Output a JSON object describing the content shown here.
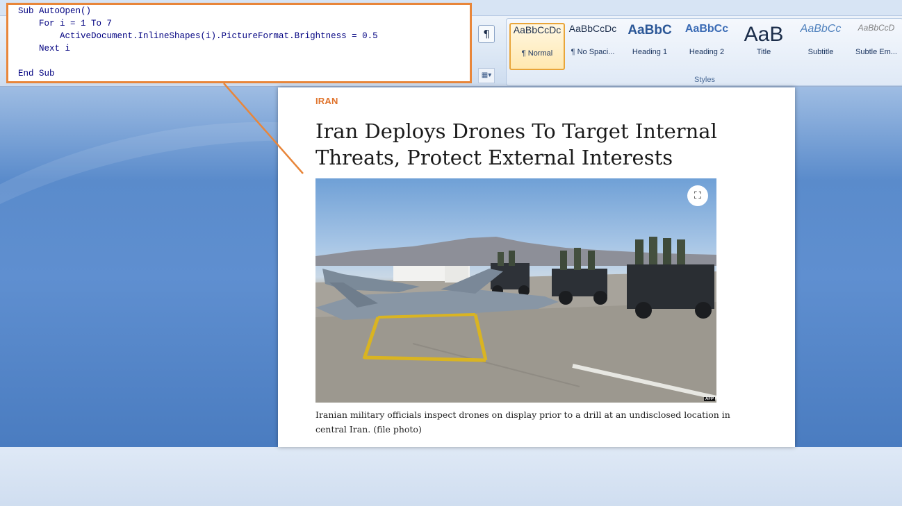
{
  "code": {
    "lines": [
      "Sub AutoOpen()",
      "    For i = 1 To 7",
      "        ActiveDocument.InlineShapes(i).PictureFormat.Brightness = 0.5",
      "    Next i",
      "",
      "End Sub"
    ]
  },
  "ribbon": {
    "paragraph_mark": "¶",
    "styles_group_label": "Styles",
    "styles": [
      {
        "sample": "AaBbCcDc",
        "label": "¶ Normal",
        "selected": true
      },
      {
        "sample": "AaBbCcDc",
        "label": "¶ No Spaci...",
        "selected": false
      },
      {
        "sample": "AaBbC",
        "label": "Heading 1",
        "selected": false
      },
      {
        "sample": "AaBbCc",
        "label": "Heading 2",
        "selected": false
      },
      {
        "sample": "AaB",
        "label": "Title",
        "selected": false
      },
      {
        "sample": "AaBbCc",
        "label": "Subtitle",
        "selected": false
      },
      {
        "sample": "AaBbCcD",
        "label": "Subtle Em...",
        "selected": false
      }
    ]
  },
  "article": {
    "kicker": "IRAN",
    "headline": "Iran Deploys Drones To Target Internal Threats, Protect External Interests",
    "photo_credit": "AFP",
    "caption": "Iranian military officials inspect drones on display prior to a drill at an undisclosed location in central Iran. (file photo)"
  },
  "colors": {
    "accent_orange": "#e8863a",
    "kicker": "#e0732b",
    "code_text": "#000080"
  }
}
